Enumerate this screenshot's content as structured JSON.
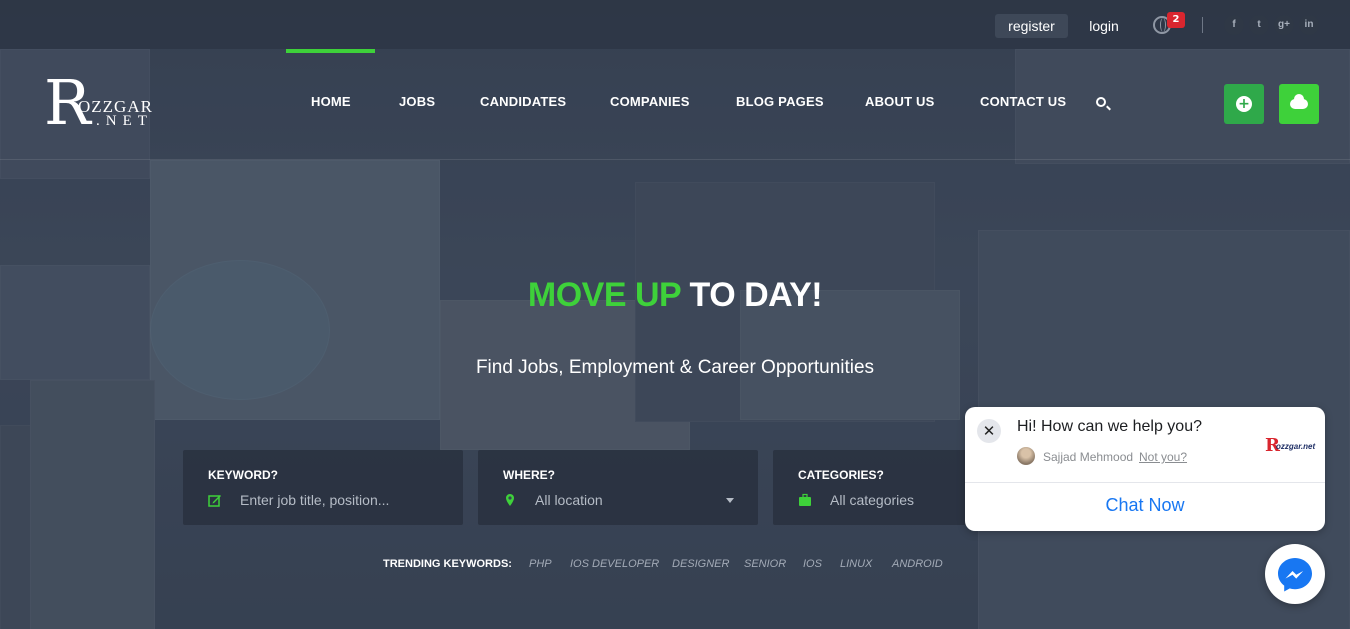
{
  "topbar": {
    "register_label": "register",
    "login_label": "login",
    "notification_count": "2",
    "social": [
      "f",
      "t",
      "g+",
      "in"
    ]
  },
  "brand": {
    "logo_initial": "R",
    "logo_text": "OZZGAR",
    "logo_sub": ".NET"
  },
  "nav": {
    "items": [
      "HOME",
      "JOBS",
      "CANDIDATES",
      "COMPANIES",
      "BLOG PAGES",
      "ABOUT US",
      "CONTACT US"
    ],
    "active": "HOME"
  },
  "hero": {
    "title_accent": "MOVE UP",
    "title_rest": " TO DAY!",
    "subtitle": "Find Jobs, Employment & Career Opportunities"
  },
  "search": {
    "keyword": {
      "label": "KEYWORD?",
      "placeholder": "Enter job title, position..."
    },
    "where": {
      "label": "WHERE?",
      "value": "All location"
    },
    "categories": {
      "label": "CATEGORIES?",
      "value": "All categories"
    }
  },
  "trending": {
    "label": "TRENDING KEYWORDS:",
    "keywords": [
      "PHP",
      "IOS DEVELOPER",
      "DESIGNER",
      "SENIOR",
      "IOS",
      "LINUX",
      "ANDROID"
    ]
  },
  "chat": {
    "greeting": "Hi! How can we help you?",
    "agent_name": "Sajjad Mehmood",
    "not_you": "Not you?",
    "logo_initial": "R",
    "logo_text": "ozzgar.net",
    "cta": "Chat Now"
  },
  "colors": {
    "accent_green": "#3ed13a",
    "dark_green": "#2fa94a",
    "messenger_blue": "#1877f2",
    "badge_red": "#d9262f"
  }
}
